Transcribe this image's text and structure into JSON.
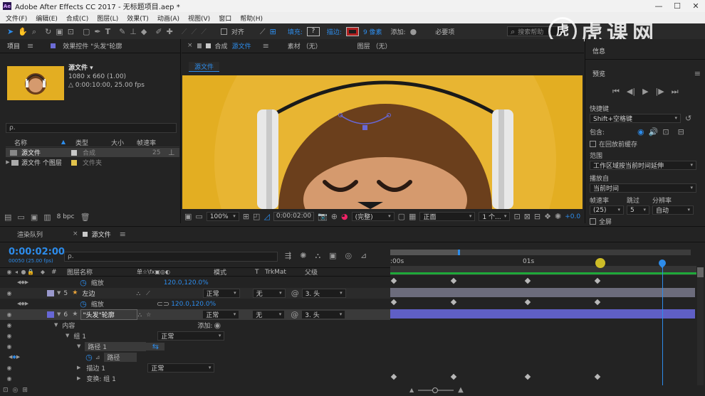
{
  "titlebar": {
    "app_icon": "Ae",
    "title": "Adobe After Effects CC 2017 - 无标题项目.aep *"
  },
  "menu": [
    "文件(F)",
    "编辑(E)",
    "合成(C)",
    "图层(L)",
    "效果(T)",
    "动画(A)",
    "视图(V)",
    "窗口",
    "帮助(H)"
  ],
  "toolbar": {
    "align_label": "对齐",
    "fill_label": "填充:",
    "fill_value": "?",
    "stroke_label": "描边:",
    "stroke_px": "9 像素",
    "add_label": "添加:",
    "workspace_label": "必要项",
    "search_placeholder": "搜索帮助"
  },
  "watermark": "虎课网",
  "project_panel": {
    "tab": "项目",
    "effects_tab": "效果控件 \"头发\"轮廓",
    "item_name": "源文件 ▾",
    "item_size": "1080 x 660 (1.00)",
    "item_duration": "△ 0:00:10:00, 25.00 fps",
    "search_placeholder": "ρ.",
    "columns": [
      "名称",
      "类型",
      "大小",
      "帧速率"
    ],
    "rows": [
      {
        "name": "源文件",
        "type": "合成",
        "size": "",
        "fps": "25"
      },
      {
        "name": "源文件 个图层",
        "type": "文件夹",
        "size": "",
        "fps": ""
      }
    ],
    "bpc": "8 bpc"
  },
  "comp_panel": {
    "tab_prefix": "合成",
    "tab": "源文件",
    "footage_tab": "素材 （无）",
    "layer_tab": "图层 （无）",
    "breadcrumb": "源文件",
    "zoom": "100%",
    "timecode": "0:00:02:00",
    "quality": "(完整)",
    "view": "正面",
    "views_count": "1 个...",
    "offset": "+0.0"
  },
  "right_panel": {
    "info": "信息",
    "preview": "预览",
    "shortcut_label": "快捷键",
    "shortcut_value": "Shift+空格键",
    "include_label": "包含:",
    "cache_label": "在回放前缓存",
    "range_label": "范围",
    "range_value": "工作区域按当前时间延伸",
    "play_from_label": "播放自",
    "play_from_value": "当前时间",
    "fps_label": "帧速率",
    "skip_label": "跳过",
    "res_label": "分辨率",
    "fps_value": "(25)",
    "skip_value": "5",
    "res_value": "自动",
    "fullscreen_label": "全屏"
  },
  "timeline": {
    "render_tab": "渲染队列",
    "comp_tab": "源文件",
    "timecode": "0:00:02:00",
    "frame_info": "00050 (25.00 fps)",
    "search_placeholder": "ρ.",
    "columns": {
      "layer_name": "图层名称",
      "switches": "单☆\\fx▣◎◐",
      "mode": "模式",
      "t": "T",
      "trkmat": "TrkMat",
      "parent": "父级"
    },
    "ruler": {
      "start": ":00s",
      "mid": "01s"
    },
    "rows": [
      {
        "kind": "prop",
        "label": "缩放",
        "value": "120.0,120.0%"
      },
      {
        "kind": "layer",
        "num": "5",
        "name": "左边",
        "mode": "正常",
        "trkmat": "无",
        "parent": "3. 头"
      },
      {
        "kind": "prop",
        "label": "缩放",
        "value": "120.0,120.0%"
      },
      {
        "kind": "layer",
        "num": "6",
        "name": "\"头发\"轮廓",
        "mode": "正常",
        "trkmat": "无",
        "parent": "3. 头"
      },
      {
        "kind": "group",
        "label": "内容",
        "add": "添加:"
      },
      {
        "kind": "group",
        "label": "组 1",
        "mode": "正常"
      },
      {
        "kind": "group",
        "label": "路径 1"
      },
      {
        "kind": "prop",
        "label": "路径"
      },
      {
        "kind": "group",
        "label": "描边 1",
        "mode": "正常"
      },
      {
        "kind": "group",
        "label": "变换: 组 1"
      }
    ]
  },
  "colors": {
    "accent": "#2d8ceb",
    "comp_bg": "#e3ae22",
    "layer5_label": "#9998cc",
    "layer6_bar": "#5f5fc5"
  }
}
